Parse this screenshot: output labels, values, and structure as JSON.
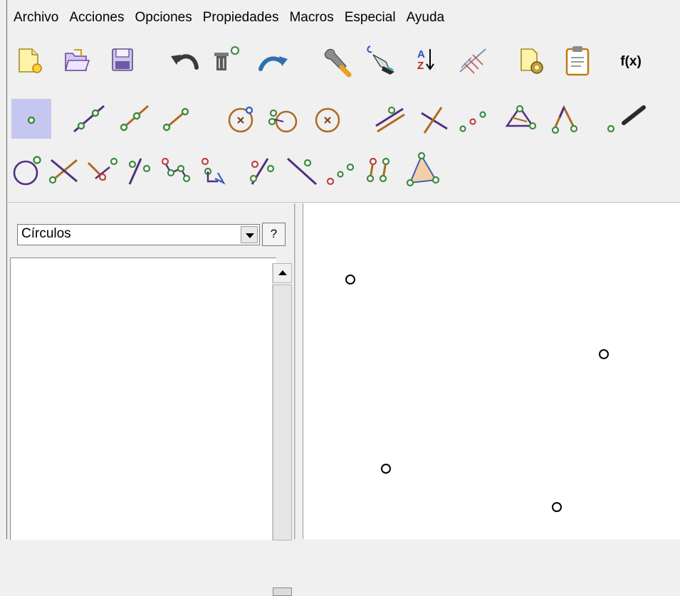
{
  "menu": [
    "Archivo",
    "Acciones",
    "Opciones",
    "Propiedades",
    "Macros",
    "Especial",
    "Ayuda"
  ],
  "toolbar": {
    "row1": [
      "new-file-icon",
      "open-file-icon",
      "save-file-icon",
      "undo-icon",
      "delete-icon",
      "redo-icon",
      "edit-properties-icon",
      "color-icon",
      "sort-icon",
      "grid-icon",
      "document-settings-icon",
      "clipboard-icon",
      "function-icon"
    ],
    "row2": [
      "point-icon",
      "line-icon",
      "ray-icon",
      "segment-icon",
      "circle-icon",
      "circle-two-points-icon",
      "circle-center-icon",
      "parallel-icon",
      "perpendicular-icon",
      "midpoint-icon",
      "triangle-icon",
      "angle-icon",
      "pen-icon"
    ],
    "row3": [
      "circle-point-icon",
      "intersection-icon",
      "intersection-point-icon",
      "line-point-icon",
      "move-point-icon",
      "reflect-icon",
      "fixed-angle-icon",
      "line-through-icon",
      "collinear-icon",
      "locus-icon",
      "polygon-icon"
    ],
    "function_label": "f(x)"
  },
  "panel": {
    "category": "Círculos",
    "help_label": "?"
  },
  "canvas": {
    "points": [
      "point-a",
      "point-b",
      "point-c",
      "point-d"
    ]
  },
  "colors": {
    "active_tool": "#c5c7f0",
    "point_green": "#5fa35a",
    "line_purple": "#503080",
    "line_brown": "#b06a20"
  }
}
